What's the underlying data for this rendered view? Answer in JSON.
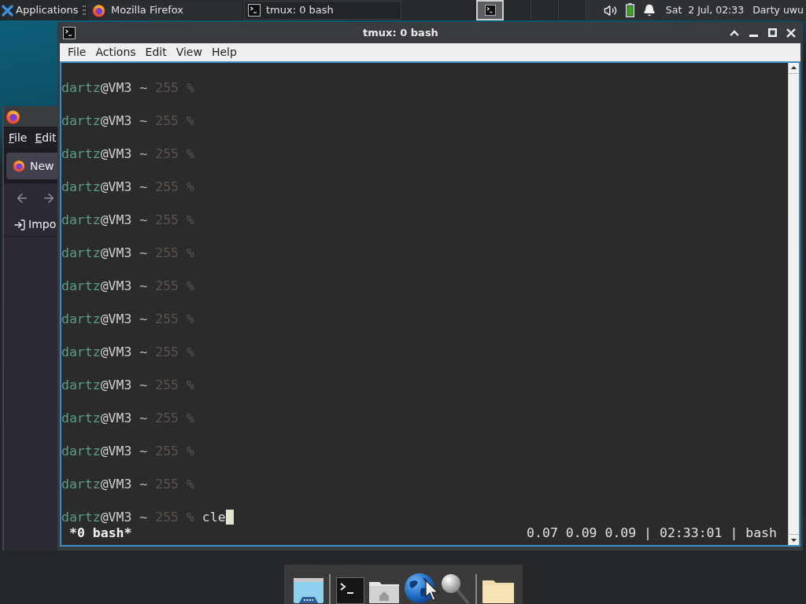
{
  "top_panel": {
    "menu_label": "Applications",
    "tasks": [
      {
        "title": "Mozilla Firefox",
        "kind": "browser",
        "selected": false
      },
      {
        "title": "tmux: 0 bash",
        "kind": "terminal",
        "selected": true
      }
    ],
    "workspaces": [
      {
        "selected": true,
        "occupied": true
      },
      {
        "selected": false,
        "occupied": false
      },
      {
        "selected": false,
        "occupied": false
      },
      {
        "selected": false,
        "occupied": false
      }
    ],
    "clock": "Sat  2 Jul, 02:33",
    "user": "Darty uwu"
  },
  "background_window": {
    "menu": [
      "File",
      "Edit"
    ],
    "tab": "New",
    "bookmark": "Impo"
  },
  "terminal_window": {
    "title": "tmux: 0 bash",
    "menu": [
      "File",
      "Actions",
      "Edit",
      "View",
      "Help"
    ],
    "lines": [
      {
        "user": "dartz",
        "host": "@VM3",
        "cwd": "~",
        "exit_code": "255",
        "symbol": "%",
        "cursor": false
      },
      {
        "user": "dartz",
        "host": "@VM3",
        "cwd": "~",
        "exit_code": "255",
        "symbol": "%",
        "cursor": false
      },
      {
        "user": "dartz",
        "host": "@VM3",
        "cwd": "~",
        "exit_code": "255",
        "symbol": "%",
        "cursor": false
      },
      {
        "user": "dartz",
        "host": "@VM3",
        "cwd": "~",
        "exit_code": "255",
        "symbol": "%",
        "cursor": false
      },
      {
        "user": "dartz",
        "host": "@VM3",
        "cwd": "~",
        "exit_code": "255",
        "symbol": "%",
        "cursor": false
      },
      {
        "user": "dartz",
        "host": "@VM3",
        "cwd": "~",
        "exit_code": "255",
        "symbol": "%",
        "cursor": false
      },
      {
        "user": "dartz",
        "host": "@VM3",
        "cwd": "~",
        "exit_code": "255",
        "symbol": "%",
        "cursor": false
      },
      {
        "user": "dartz",
        "host": "@VM3",
        "cwd": "~",
        "exit_code": "255",
        "symbol": "%",
        "cursor": false
      },
      {
        "user": "dartz",
        "host": "@VM3",
        "cwd": "~",
        "exit_code": "255",
        "symbol": "%",
        "cursor": false
      },
      {
        "user": "dartz",
        "host": "@VM3",
        "cwd": "~",
        "exit_code": "255",
        "symbol": "%",
        "cursor": false
      },
      {
        "user": "dartz",
        "host": "@VM3",
        "cwd": "~",
        "exit_code": "255",
        "symbol": "%",
        "cursor": false
      },
      {
        "user": "dartz",
        "host": "@VM3",
        "cwd": "~",
        "exit_code": "255",
        "symbol": "%",
        "cursor": false
      },
      {
        "user": "dartz",
        "host": "@VM3",
        "cwd": "~",
        "exit_code": "255",
        "symbol": "%",
        "cursor": false
      },
      {
        "user": "dartz",
        "host": "@VM3",
        "cwd": "~",
        "exit_code": "255",
        "symbol": "%",
        "command": "cle",
        "cursor": true
      }
    ],
    "status_left": "*0 bash*",
    "status_right": "0.07 0.09 0.09 | 02:33:01 | bash"
  },
  "dock": {
    "items": [
      {
        "kind": "show-desktop"
      },
      {
        "kind": "separator"
      },
      {
        "kind": "terminal"
      },
      {
        "kind": "home"
      },
      {
        "kind": "browser"
      },
      {
        "kind": "search"
      },
      {
        "kind": "separator"
      },
      {
        "kind": "files"
      }
    ]
  }
}
